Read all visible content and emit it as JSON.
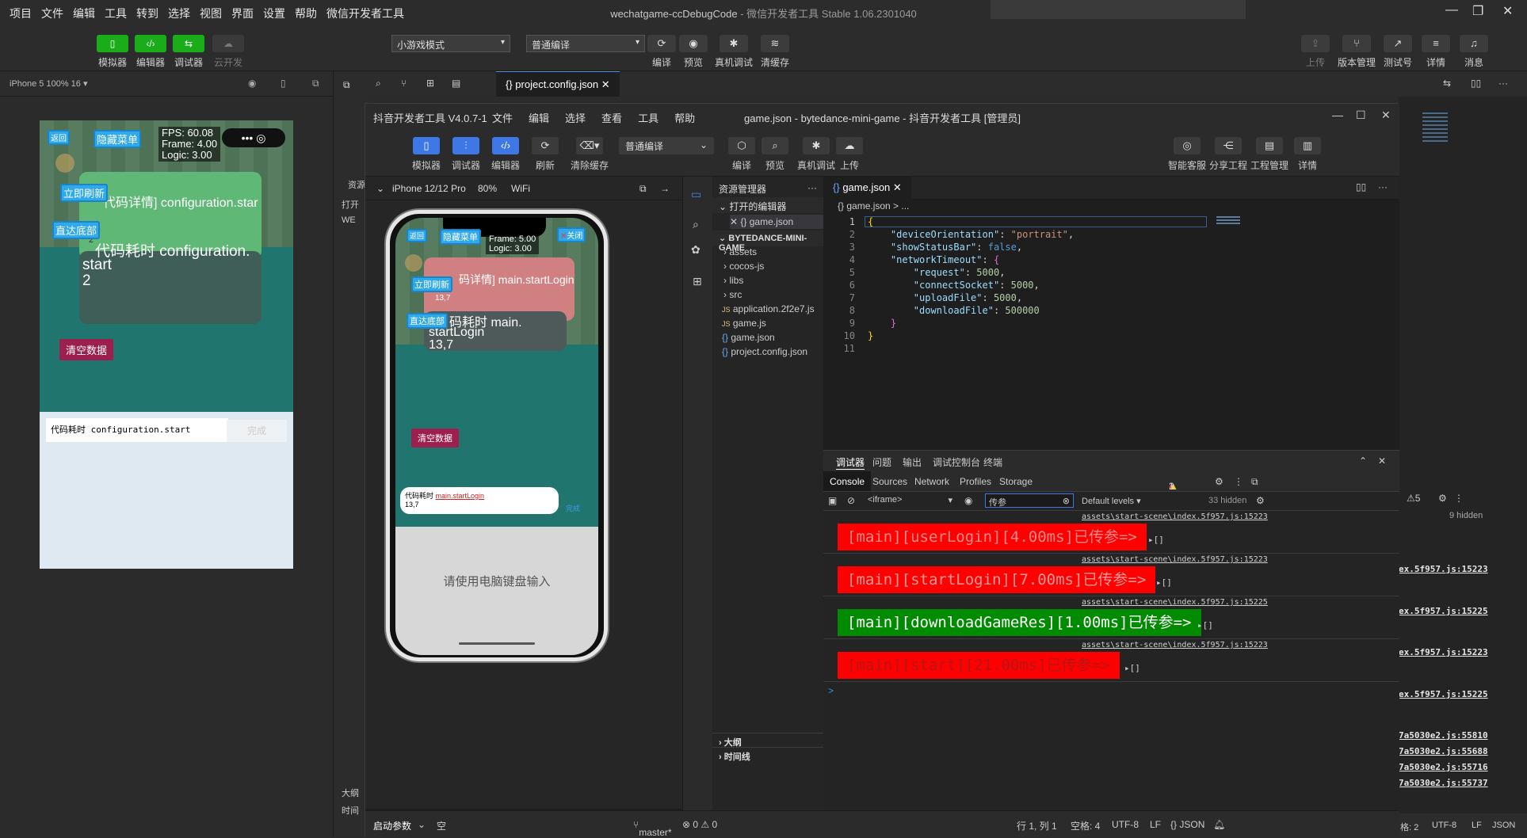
{
  "wechat": {
    "menu": [
      "项目",
      "文件",
      "编辑",
      "工具",
      "转到",
      "选择",
      "视图",
      "界面",
      "设置",
      "帮助",
      "微信开发者工具"
    ],
    "title_main": "wechatgame-ccDebugCode",
    "title_sub": " - 微信开发者工具 Stable 1.06.2301040",
    "toolbar": {
      "simulator": "模拟器",
      "editor": "编辑器",
      "debugger": "调试器",
      "cloud": "云开发",
      "mode": "小游戏模式",
      "compile_mode": "普通编译",
      "compile": "编译",
      "preview": "预览",
      "real_debug": "真机调试",
      "clear_cache": "清缓存",
      "upload": "上传",
      "version": "版本管理",
      "test": "测试号",
      "details": "详情",
      "messages": "消息"
    },
    "device": "iPhone 5 100% 16 ▾",
    "tab_file": "project.config.json",
    "game": {
      "back": "返回",
      "hide_menu": "隐藏菜单",
      "fps": "FPS: 60.08",
      "frame": "Frame: 4.00",
      "logic": "Logic: 3.00",
      "refresh": "立即刷新",
      "bottom": "直达底部",
      "card1": "代码详情] configuration.star",
      "card1_sub": "2",
      "card2": "代码耗时 configuration.",
      "card2_l2": "start",
      "card2_l3": "2",
      "clear": "清空数据",
      "input_text": "代码耗时 configuration.start",
      "input_sub": "2",
      "done": "完成"
    },
    "sidebar_labels": [
      "资源",
      "打开",
      "WE",
      "大纲",
      "时间"
    ],
    "right_console": {
      "warn": "5",
      "hidden": "9 hidden",
      "links": [
        "ex.5f957.js:15223",
        "ex.5f957.js:15225",
        "ex.5f957.js:15223",
        "ex.5f957.js:15225",
        "7a5030e2.js:55810",
        "7a5030e2.js:55688",
        "7a5030e2.js:55716",
        "7a5030e2.js:55737"
      ],
      "status": [
        "格: 2",
        "UTF-8",
        "LF",
        "JSON"
      ]
    }
  },
  "douyin": {
    "app": "抖音开发者工具 V4.0.7-1",
    "menu": [
      "文件",
      "编辑",
      "选择",
      "查看",
      "工具",
      "帮助"
    ],
    "title": "game.json - bytedance-mini-game - 抖音开发者工具 [管理员]",
    "toolbar": {
      "simulator": "模拟器",
      "debugger": "调试器",
      "editor": "编辑器",
      "refresh": "刷新",
      "clear_cache": "清除缓存",
      "compile_mode": "普通编译",
      "compile": "编译",
      "preview": "预览",
      "real_debug": "真机调试",
      "upload": "上传",
      "smart_service": "智能客服",
      "share": "分享工程",
      "project_mgmt": "工程管理",
      "details": "详情"
    },
    "sim_header": {
      "device": "iPhone 12/12 Pro",
      "zoom": "80%",
      "network": "WiFi"
    },
    "game": {
      "back": "返回",
      "hide_menu": "隐藏菜单",
      "close": "关闭",
      "frame": "Frame: 5.00",
      "logic": "Logic: 3.00",
      "card1": "码详情] main.startLogin",
      "card1_sub": "13,7",
      "card2": "码耗时 main.",
      "card2_l2": "startLogin",
      "card2_l3": "13,7",
      "refresh": "立即刷新",
      "bottom": "直达底部",
      "clear": "清空数据",
      "input_label": "代码耗时",
      "input_value": "main.startLogin",
      "input_sub": "13,7",
      "done": "完成",
      "keyboard_hint": "请使用电脑键盘输入"
    },
    "explorer": {
      "title": "资源管理器",
      "open_editors": "打开的编辑器",
      "open_file": "game.json",
      "project": "BYTEDANCE-MINI-GAME",
      "items": [
        "assets",
        "cocos-js",
        "libs",
        "src",
        "application.2f2e7.js",
        "game.js",
        "game.json",
        "project.config.json"
      ],
      "outline": "大纲",
      "timeline": "时间线"
    },
    "editor": {
      "tab": "game.json",
      "breadcrumb": "{} game.json > ...",
      "lines": [
        "1",
        "2",
        "3",
        "4",
        "5",
        "6",
        "7",
        "8",
        "9",
        "10",
        "11"
      ]
    },
    "devtools": {
      "panel_tabs": [
        "调试器",
        "问题",
        "输出",
        "调试控制台",
        "终端"
      ],
      "tabs": [
        "Console",
        "Sources",
        "Network",
        "Profiles",
        "Storage"
      ],
      "errors": "1",
      "warnings": "3",
      "context": "<iframe>",
      "filter": "传参",
      "levels": "Default levels ▾",
      "hidden": "33 hidden",
      "logs": [
        {
          "src": "assets\\start-scene\\index.5f957.js:15223",
          "msg": "[main][userLogin][4.00ms]已传参=>",
          "color": "#ff0000",
          "text_color": "#ff7070",
          "arr": "▸[]"
        },
        {
          "src": "assets\\start-scene\\index.5f957.js:15223",
          "msg": "[main][startLogin][7.00ms]已传参=>",
          "color": "#ff0000",
          "text_color": "#ff8080",
          "arr": "▸[]"
        },
        {
          "src": "assets\\start-scene\\index.5f957.js:15225",
          "msg": "[main][downloadGameRes][1.00ms]已传参=>",
          "color": "#008b00",
          "text_color": "#ffffff",
          "arr": "▸[]"
        },
        {
          "src": "assets\\start-scene\\index.5f957.js:15223",
          "msg": "[main][start][21.00ms]已传参=>",
          "color": "#ff0000",
          "text_color": "#b01010",
          "arr": "▸[]"
        }
      ],
      "prompt": ">"
    },
    "status": {
      "launch": "启动参数",
      "empty": "空",
      "branch": "master*",
      "problems": "⊗ 0 ⚠ 0",
      "pos": "行 1, 列 1",
      "spaces": "空格: 4",
      "encoding": "UTF-8",
      "eol": "LF",
      "lang": "{} JSON"
    }
  }
}
